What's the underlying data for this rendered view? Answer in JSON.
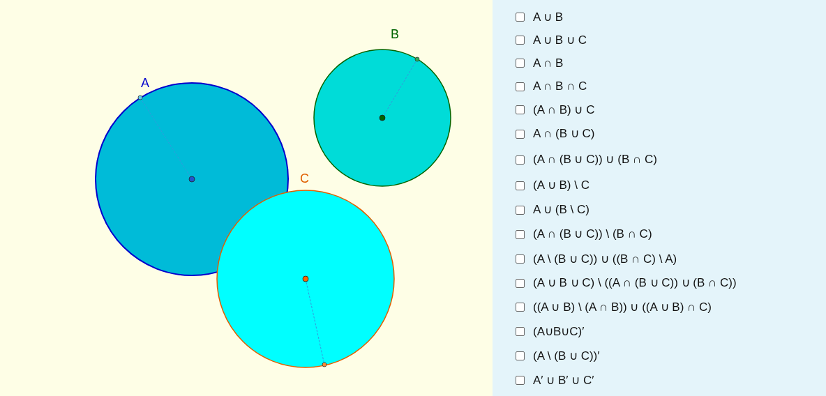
{
  "canvas": {
    "circles": [
      {
        "label": "A",
        "color": "#0000cc"
      },
      {
        "label": "B",
        "color": "#006400"
      },
      {
        "label": "C",
        "color": "#e06000"
      }
    ]
  },
  "checkboxes": [
    {
      "label": "A ∪ B",
      "checked": false
    },
    {
      "label": "A ∪ B ∪ C",
      "checked": false
    },
    {
      "label": "A ∩ B",
      "checked": false
    },
    {
      "label": "A ∩ B ∩ C",
      "checked": false
    },
    {
      "label": "(A ∩ B) ∪ C",
      "checked": false
    },
    {
      "label": "A ∩ (B ∪ C)",
      "checked": false
    },
    {
      "label": "(A ∩ (B ∪ C)) ∪ (B ∩ C)",
      "checked": false
    },
    {
      "label": "(A ∪ B) \\ C",
      "checked": false
    },
    {
      "label": "A ∪ (B \\ C)",
      "checked": false
    },
    {
      "label": "(A ∩ (B ∪ C)) \\ (B ∩ C)",
      "checked": false
    },
    {
      "label": "(A \\ (B ∪ C)) ∪ ((B ∩ C) \\ A)",
      "checked": false
    },
    {
      "label": "(A ∪ B ∪ C) \\ ((A ∩ (B ∪ C)) ∪ (B ∩ C))",
      "checked": false
    },
    {
      "label": "((A ∪ B) \\ (A ∩ B)) ∪ ((A ∪ B) ∩ C)",
      "checked": false
    },
    {
      "label": "(A∪B∪C)′",
      "checked": false
    },
    {
      "label": "(A \\ (B ∪ C))′",
      "checked": false
    },
    {
      "label": "A′ ∪ B′ ∪ C′",
      "checked": false
    }
  ]
}
